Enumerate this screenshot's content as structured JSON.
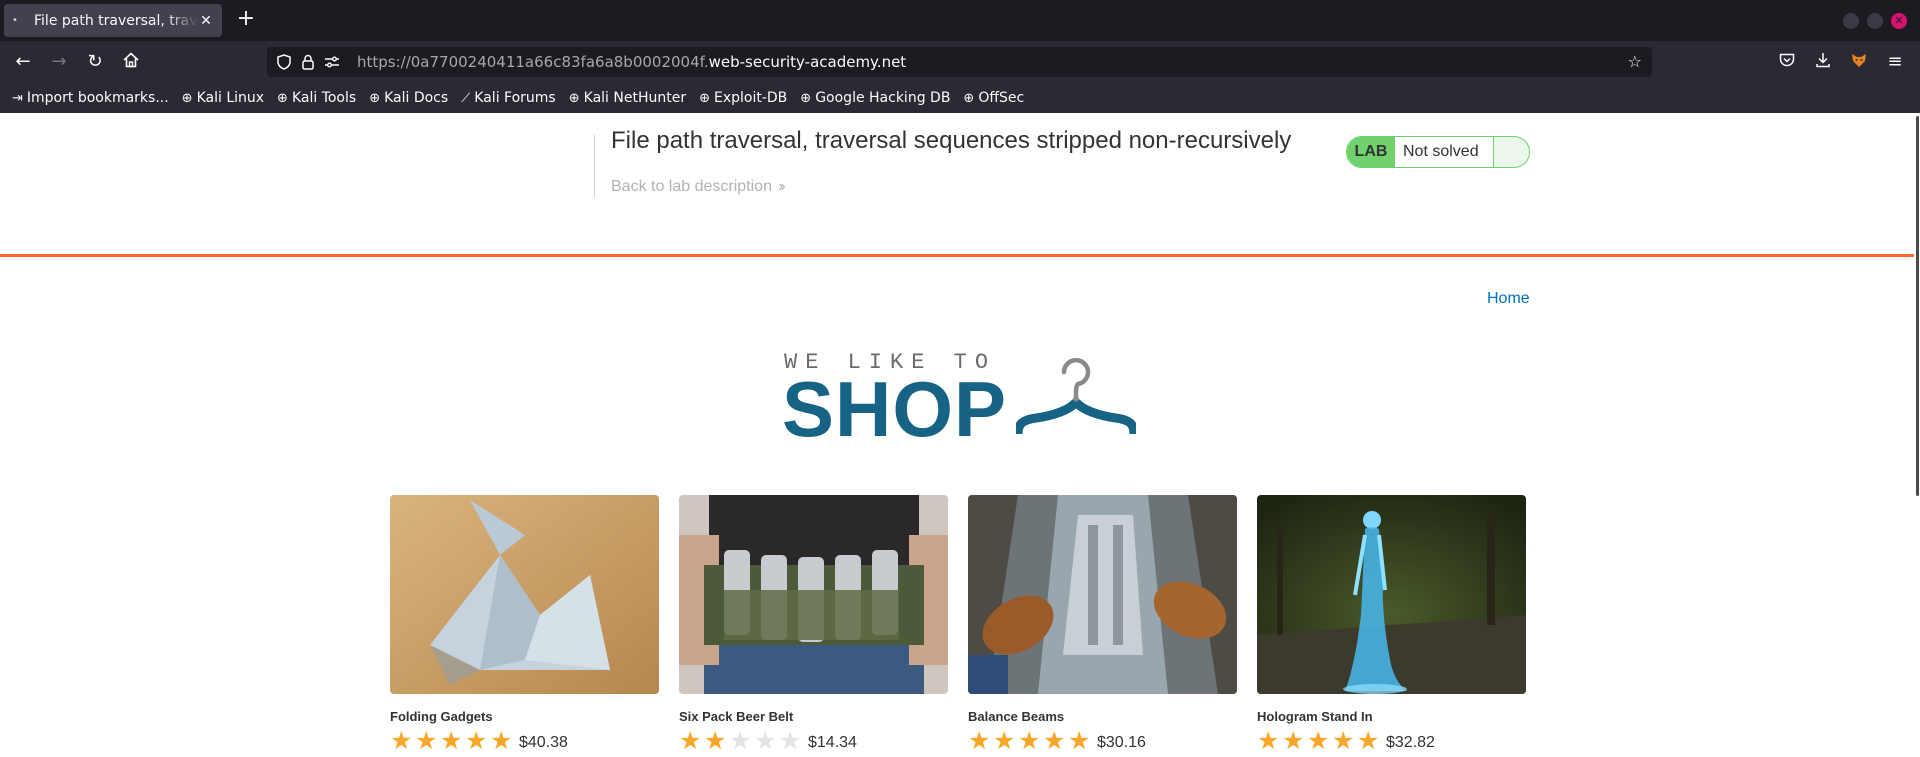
{
  "browser": {
    "tab_title": "File path traversal, traversal sequences stripped non-recursively",
    "tab_close": "✕",
    "new_tab": "+",
    "url_prefix": "https://0a7700240411a66c83fa6a8b0002004f.",
    "url_domain": "web-security-academy.net",
    "bookmarks": [
      {
        "label": "Import bookmarks...",
        "icon": "import-icon"
      },
      {
        "label": "Kali Linux",
        "icon": "globe-icon"
      },
      {
        "label": "Kali Tools",
        "icon": "globe-icon"
      },
      {
        "label": "Kali Docs",
        "icon": "globe-icon"
      },
      {
        "label": "Kali Forums",
        "icon": "kali-icon"
      },
      {
        "label": "Kali NetHunter",
        "icon": "globe-icon"
      },
      {
        "label": "Exploit-DB",
        "icon": "globe-icon"
      },
      {
        "label": "Google Hacking DB",
        "icon": "globe-icon"
      },
      {
        "label": "OffSec",
        "icon": "globe-icon"
      }
    ]
  },
  "lab": {
    "title": "File path traversal, traversal sequences stripped non-recursively",
    "back_link": "Back to lab description",
    "badge_label": "LAB",
    "status": "Not solved"
  },
  "nav": {
    "home": "Home"
  },
  "logo": {
    "tagline": "WE LIKE TO",
    "word": "SHOP"
  },
  "products": [
    {
      "name": "Folding Gadgets",
      "rating": 5,
      "price": "$40.38"
    },
    {
      "name": "Six Pack Beer Belt",
      "rating": 2,
      "price": "$14.34"
    },
    {
      "name": "Balance Beams",
      "rating": 5,
      "price": "$30.16"
    },
    {
      "name": "Hologram Stand In",
      "rating": 5,
      "price": "$32.82"
    }
  ],
  "colors": {
    "accent_orange": "#ff6633",
    "lab_green": "#70d16d",
    "link_blue": "#0071bc",
    "logo_blue": "#176386",
    "star_gold": "#f8a72a"
  }
}
